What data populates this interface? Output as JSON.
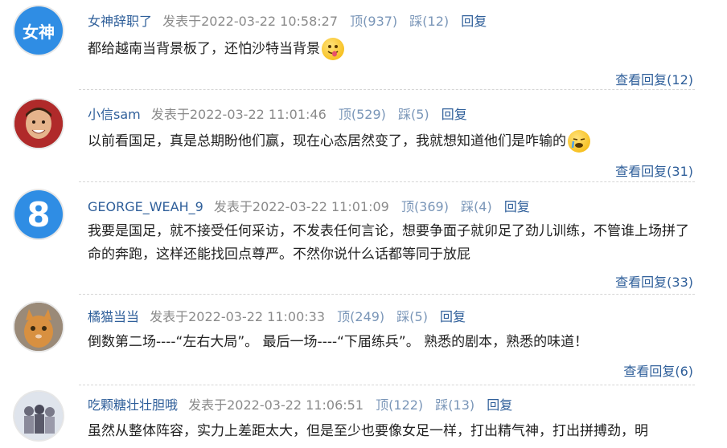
{
  "comments": [
    {
      "username": "女神辞职了",
      "posted": "发表于2022-03-22 10:58:27",
      "up": "顶(937)",
      "down": "踩(12)",
      "reply": "回复",
      "text": "都给越南当背景板了，还怕沙特当背景",
      "view_replies": "查看回复(12)",
      "avatar_text": "女神"
    },
    {
      "username": "小信sam",
      "posted": "发表于2022-03-22 11:01:46",
      "up": "顶(529)",
      "down": "踩(5)",
      "reply": "回复",
      "text": "以前看国足，真是总期盼他们赢，现在心态居然变了，我就想知道他们是咋输的",
      "view_replies": "查看回复(31)"
    },
    {
      "username": "GEORGE_WEAH_9",
      "posted": "发表于2022-03-22 11:01:09",
      "up": "顶(369)",
      "down": "踩(4)",
      "reply": "回复",
      "text": "我要是国足，就不接受任何采访，不发表任何言论，想要争面子就卯足了劲儿训练，不管谁上场拼了命的奔跑，这样还能找回点尊严。不然你说什么话都等同于放屁",
      "view_replies": "查看回复(33)",
      "avatar_text": "8"
    },
    {
      "username": "橘猫当当",
      "posted": "发表于2022-03-22 11:00:33",
      "up": "顶(249)",
      "down": "踩(5)",
      "reply": "回复",
      "text": "倒数第二场----“左右大局”。 最后一场----“下届练兵”。 熟悉的剧本，熟悉的味道！",
      "view_replies": "查看回复(6)"
    },
    {
      "username": "吃颗糖壮壮胆哦",
      "posted": "发表于2022-03-22 11:06:51",
      "up": "顶(122)",
      "down": "踩(13)",
      "reply": "回复",
      "text": "虽然从整体阵容，实力上差距太大，但是至少也要像女足一样，打出精气神，打出拼搏劲，明"
    }
  ],
  "colors": {
    "username": "#2f5f9a",
    "meta": "#8a8a8a",
    "action": "#7a96b8",
    "text": "#222222"
  }
}
